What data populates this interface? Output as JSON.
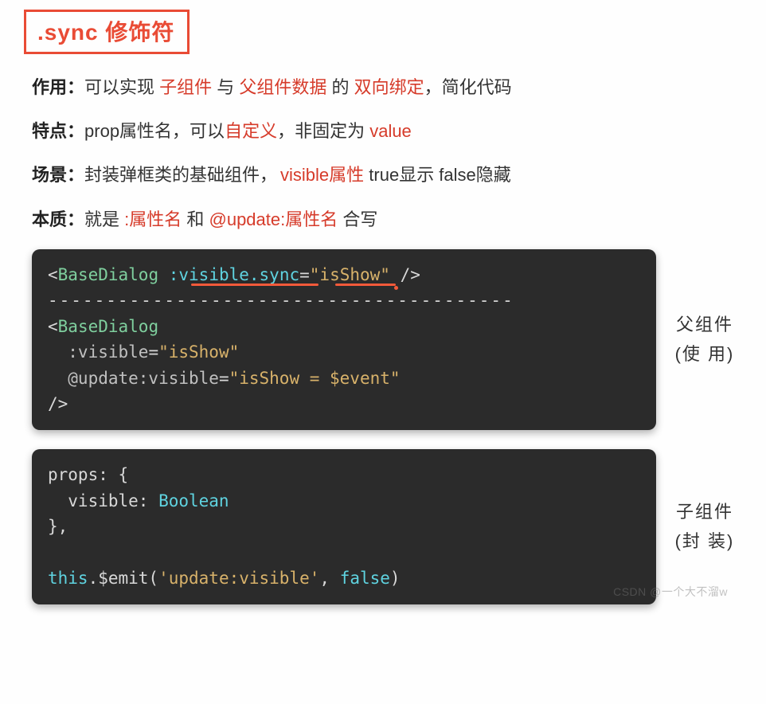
{
  "title": ".sync 修饰符",
  "lines": {
    "l1": {
      "label": "作用：",
      "t1": "可以实现 ",
      "r1": "子组件",
      "t2": " 与 ",
      "r2": "父组件数据",
      "t3": " 的 ",
      "r3": "双向绑定",
      "t4": "，简化代码"
    },
    "l2": {
      "label": "特点：",
      "t1": "prop属性名，可以",
      "r1": "自定义",
      "t2": "，非固定为 ",
      "r2": "value"
    },
    "l3": {
      "label": "场景：",
      "t1": "封装弹框类的基础组件，",
      "r1": "visible属性",
      "t2": "  true显示 false隐藏"
    },
    "l4": {
      "label": "本质：",
      "t1": "就是 ",
      "r1": ":属性名",
      "t2": " 和 ",
      "r2": "@update:属性名",
      "t3": " 合写"
    }
  },
  "code1": {
    "ln1_open": "<",
    "ln1_tag": "BaseDialog",
    "ln1_sp": " ",
    "ln1_attr": ":visible.sync",
    "ln1_eq": "=",
    "ln1_val": "\"isShow\"",
    "ln1_close": " />",
    "dash": "----------------------------------------",
    "ln2_open": "<",
    "ln2_tag": "BaseDialog",
    "ln3_attr": "  :visible",
    "ln3_eq": "=",
    "ln3_val": "\"isShow\"",
    "ln4_attr": "  @update:visible",
    "ln4_eq": "=",
    "ln4_val": "\"isShow = $event\"",
    "ln5": "/>"
  },
  "label1": {
    "a": "父组件",
    "b": "(使  用)"
  },
  "code2": {
    "ln1": "props: {",
    "ln2a": "  visible: ",
    "ln2b": "Boolean",
    "ln3": "},",
    "blank": "",
    "ln4a": "this",
    "ln4b": ".$emit(",
    "ln4c": "'update:visible'",
    "ln4d": ", ",
    "ln4e": "false",
    "ln4f": ")"
  },
  "label2": {
    "a": "子组件",
    "b": "(封  装)"
  },
  "watermark": "CSDN @一个大不溜w"
}
